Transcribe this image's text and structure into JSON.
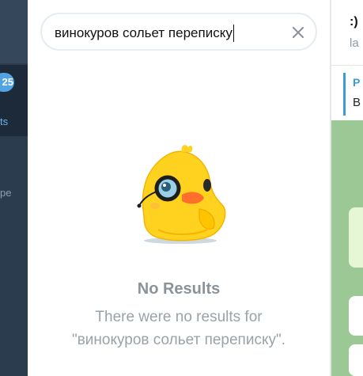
{
  "sidebar": {
    "unread_badge": "25",
    "active_folder_label": "ts",
    "second_folder_label": "pe"
  },
  "search": {
    "query": "винокуров сольет переписку"
  },
  "results": {
    "title": "No Results",
    "description_line1": "There were no results for",
    "description_line2": "\"винокуров сольет переписку\"."
  },
  "chat": {
    "title": ":)",
    "status": "la",
    "pinned_title": "P",
    "pinned_text": "B"
  },
  "colors": {
    "rail_bg": "#2b3c4f",
    "badge": "#52a3e2",
    "accent": "#3a9bd6",
    "chat_wallpaper": "#9cc895"
  },
  "icons": {
    "clear": "close-icon",
    "sticker": "duck-with-magnifier-sticker"
  }
}
